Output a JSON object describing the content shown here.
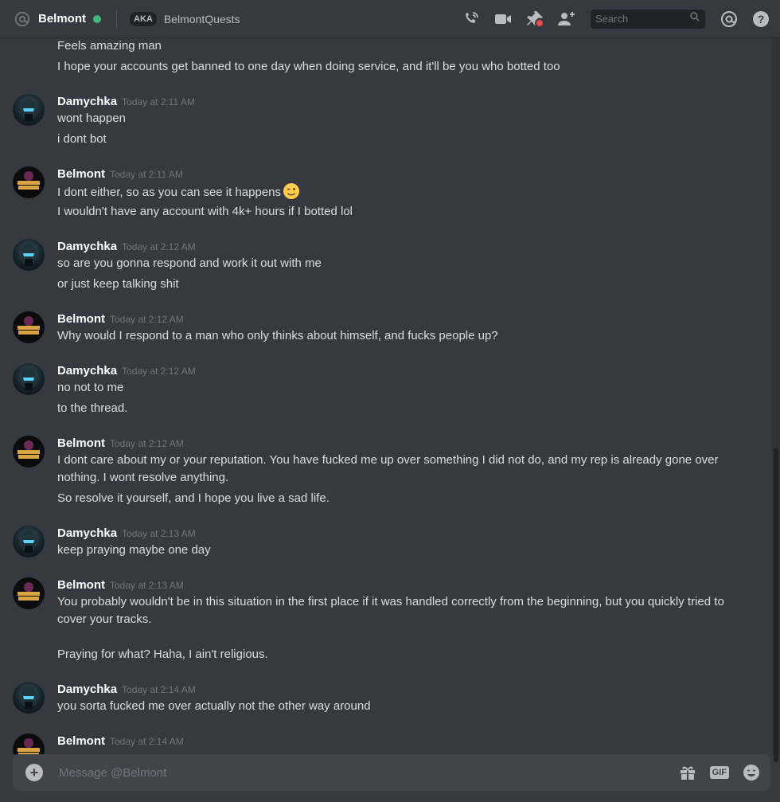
{
  "header": {
    "title": "Belmont",
    "aka_badge": "AKA",
    "aka_name": "BelmontQuests",
    "search_placeholder": "Search",
    "status_color": "#43b581"
  },
  "icons": [
    "at-icon",
    "call-icon",
    "video-icon",
    "pin-icon",
    "add-friend-icon",
    "search-icon",
    "mention-icon",
    "help-icon",
    "add-icon",
    "gift-icon",
    "gif-icon",
    "emoji-icon",
    "wink-emoji-icon"
  ],
  "messages": [
    {
      "lines": [
        "Feels amazing man",
        "I hope your accounts get banned to one day when doing service, and it'll be you who botted too"
      ]
    },
    {
      "author": "Damychka",
      "time": "Today at 2:11 AM",
      "lines": [
        "wont happen",
        "i dont bot"
      ]
    },
    {
      "author": "Belmont",
      "time": "Today at 2:11 AM",
      "lines": [
        "I dont either, so as you can see it happens",
        "I wouldn't have any account with 4k+ hours if I botted lol"
      ]
    },
    {
      "author": "Damychka",
      "time": "Today at 2:12 AM",
      "lines": [
        "so are you gonna respond and work it out with me",
        "or just keep talking shit"
      ]
    },
    {
      "author": "Belmont",
      "time": "Today at 2:12 AM",
      "lines": [
        "Why would I respond to a man who only thinks about himself, and fucks people up?"
      ]
    },
    {
      "author": "Damychka",
      "time": "Today at 2:12 AM",
      "lines": [
        "no not to me",
        "to the thread."
      ]
    },
    {
      "author": "Belmont",
      "time": "Today at 2:12 AM",
      "lines": [
        "I dont care about my or your reputation. You have fucked me up over something I did not do, and my rep is already gone over nothing. I wont resolve anything.",
        "So resolve it yourself, and I hope you live a sad life."
      ]
    },
    {
      "author": "Damychka",
      "time": "Today at 2:13 AM",
      "lines": [
        "keep praying maybe one day"
      ]
    },
    {
      "author": "Belmont",
      "time": "Today at 2:13 AM",
      "lines": [
        "You probably wouldn't be in this situation in the first place if it was handled correctly from the beginning, but you quickly tried to cover your tracks.",
        "Praying for what? Haha, I ain't religious."
      ]
    },
    {
      "author": "Damychka",
      "time": "Today at 2:14 AM",
      "lines": [
        "you sorta fucked me over actually not the other way around"
      ]
    },
    {
      "author": "Belmont",
      "time": "Today at 2:14 AM",
      "lines": []
    }
  ],
  "composer": {
    "placeholder": "Message @Belmont",
    "gif_label": "GIF"
  }
}
